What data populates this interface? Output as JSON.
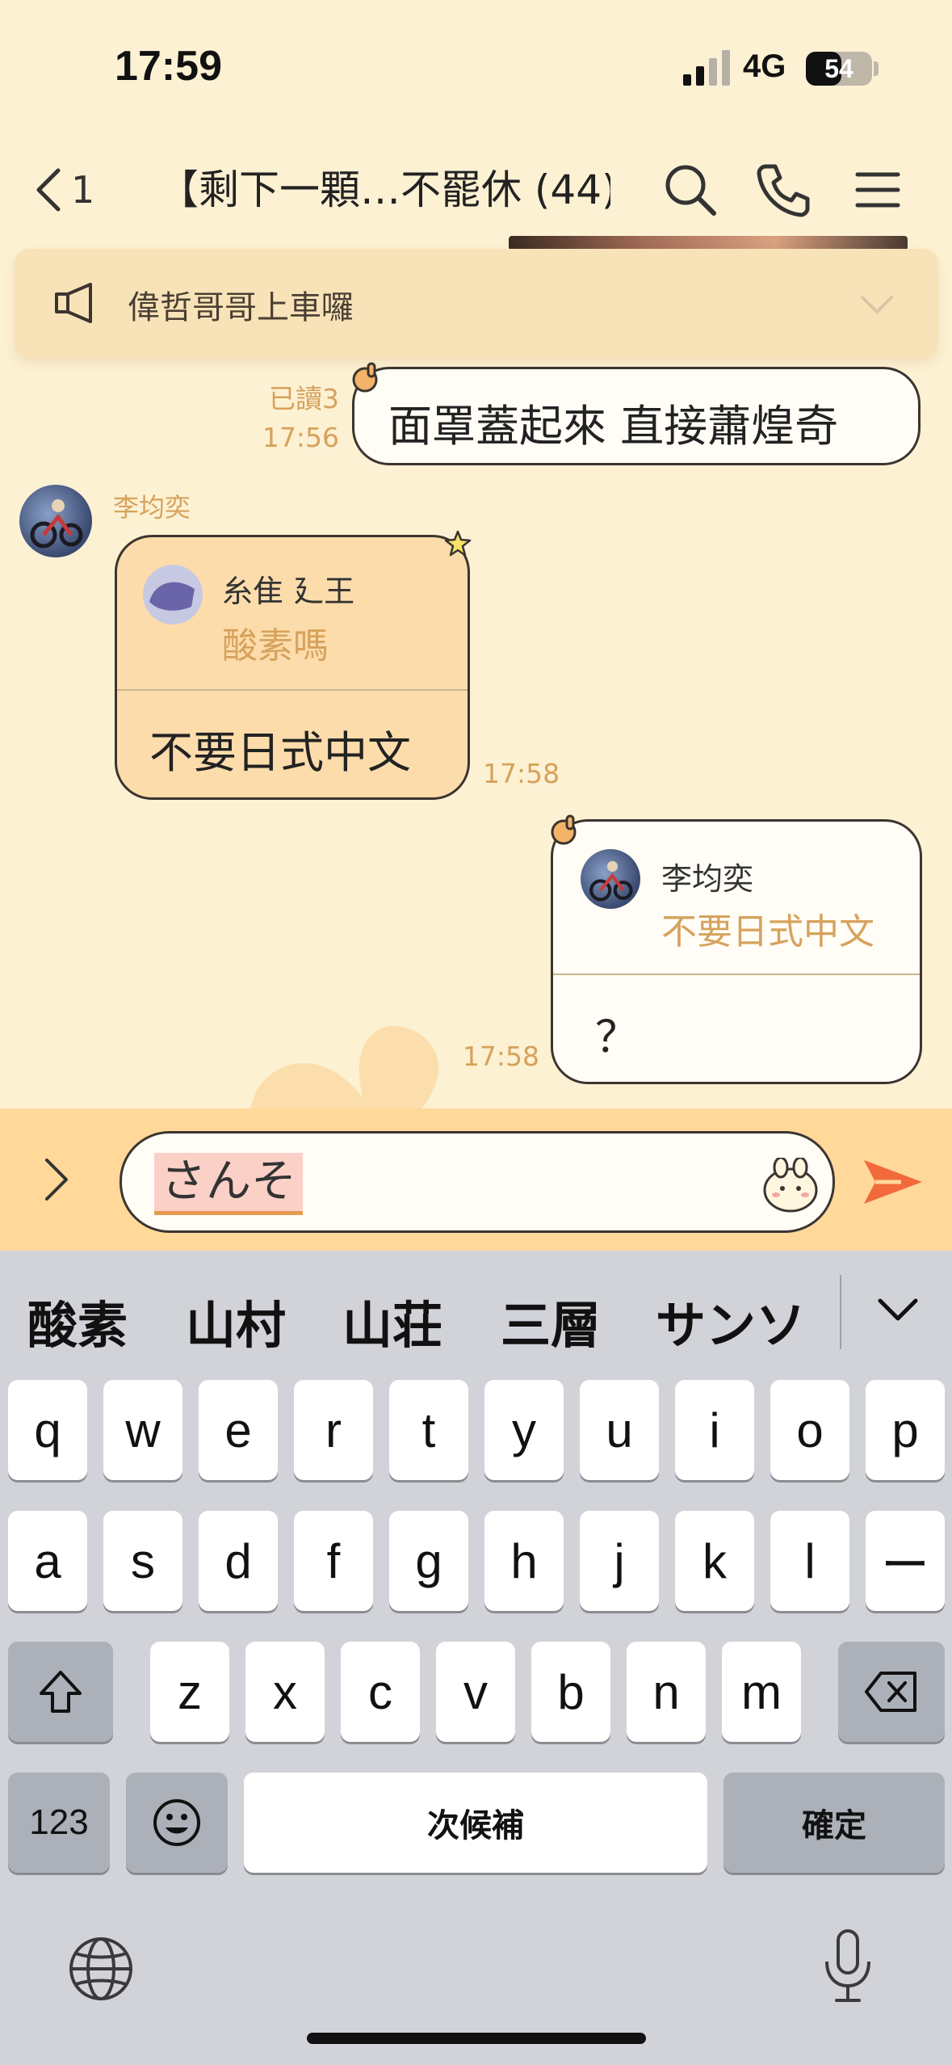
{
  "status_bar": {
    "time": "17:59",
    "network": "4G",
    "battery": "54",
    "battery_level": 0.54
  },
  "nav": {
    "back_count": "1",
    "title": "【剩下一顆…不罷休 (44)",
    "icons": [
      "back-chevron-icon",
      "search-icon",
      "phone-icon",
      "menu-icon"
    ]
  },
  "announcement": {
    "text": "偉哲哥哥上車囉",
    "icon": "megaphone-icon"
  },
  "messages": [
    {
      "id": "m1",
      "side": "right",
      "read": "已讀3",
      "time": "17:56",
      "text": "面罩蓋起來 直接蕭煌奇"
    },
    {
      "id": "m2",
      "side": "left",
      "sender": "李均奕",
      "reply_to_name": "糸隹 廴王",
      "reply_to_text": "酸素嗎",
      "text": "不要日式中文",
      "time": "17:58"
    },
    {
      "id": "m3",
      "side": "right",
      "reply_to_name": "李均奕",
      "reply_to_text": "不要日式中文",
      "text": "？",
      "time": "17:58"
    }
  ],
  "input": {
    "text": "さんそ",
    "icons": [
      "expand-chevron-icon",
      "sticker-icon",
      "send-icon"
    ]
  },
  "keyboard": {
    "suggestions": [
      "酸素",
      "山村",
      "山荘",
      "三層",
      "サンソ"
    ],
    "row1": [
      "q",
      "w",
      "e",
      "r",
      "t",
      "y",
      "u",
      "i",
      "o",
      "p"
    ],
    "row2": [
      "a",
      "s",
      "d",
      "f",
      "g",
      "h",
      "j",
      "k",
      "l",
      "ー"
    ],
    "row3": [
      "z",
      "x",
      "c",
      "v",
      "b",
      "n",
      "m"
    ],
    "numbers_key": "123",
    "space_label": "次候補",
    "confirm_label": "確定"
  },
  "colors": {
    "background": "#fdf1d3",
    "accent": "#d6a25c",
    "send": "#f26a3c",
    "keyboard": "#d1d3d9"
  }
}
